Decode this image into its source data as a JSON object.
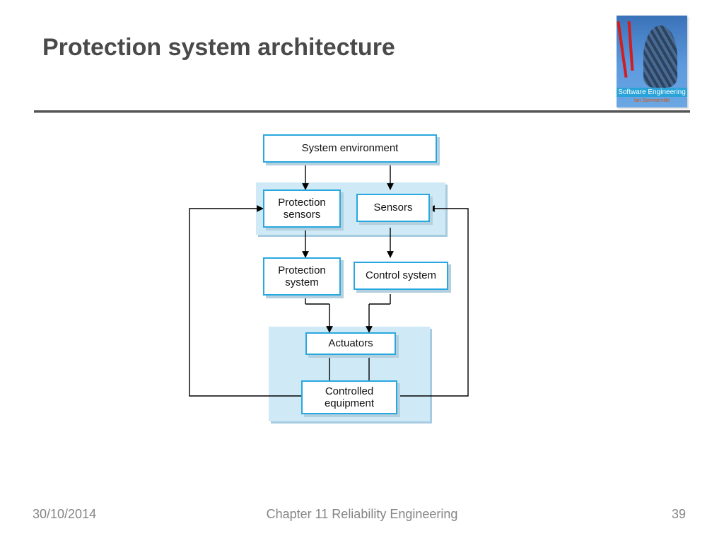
{
  "slide": {
    "title": "Protection system architecture"
  },
  "book": {
    "series": "Software Engineering",
    "author": "Ian Sommerville"
  },
  "footer": {
    "date": "30/10/2014",
    "chapter": "Chapter 11 Reliability Engineering",
    "page": "39"
  },
  "diagram": {
    "nodes": {
      "system_environment": "System environment",
      "protection_sensors": "Protection sensors",
      "sensors": "Sensors",
      "protection_system": "Protection system",
      "control_system": "Control system",
      "actuators": "Actuators",
      "controlled_equipment": "Controlled equipment"
    },
    "edges_description": "System environment → Protection sensors; System environment → Sensors; Protection sensors → Protection system; Sensors → Control system; Protection system → Actuators; Control system → Actuators; Actuators — Controlled equipment (two links); Controlled equipment → Protection sensors (feedback, left loop); Controlled equipment → Sensors (feedback, right loop)"
  }
}
